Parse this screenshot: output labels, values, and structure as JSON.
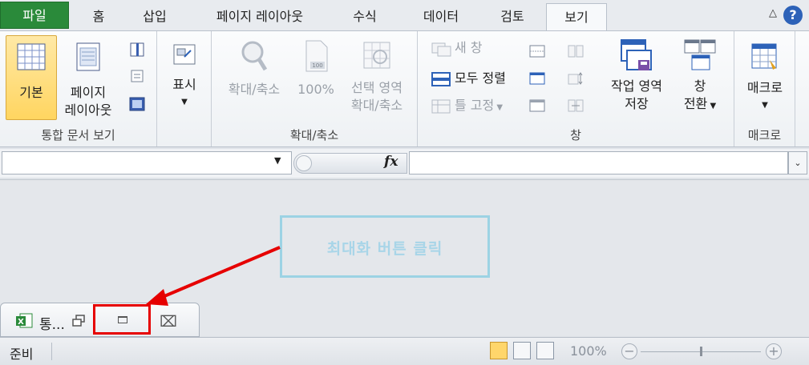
{
  "tabs": [
    {
      "label": "파일"
    },
    {
      "label": "홈"
    },
    {
      "label": "삽입"
    },
    {
      "label": "페이지 레이아웃"
    },
    {
      "label": "수식"
    },
    {
      "label": "데이터"
    },
    {
      "label": "검토"
    },
    {
      "label": "보기"
    }
  ],
  "ribbon": {
    "workbook_views": {
      "label": "통합 문서 보기",
      "normal": "기본",
      "page_layout_1": "페이지",
      "page_layout_2": "레이아웃"
    },
    "show": {
      "label": "표시"
    },
    "zoom": {
      "label": "확대/축소",
      "zoom_btn": "확대/축소",
      "hundred": "100%",
      "selection_1": "선택 영역",
      "selection_2": "확대/축소"
    },
    "window": {
      "label": "창",
      "new_window": "새 창",
      "arrange_all": "모두 정렬",
      "freeze_panes": "틀 고정",
      "save_workspace_1": "작업 영역",
      "save_workspace_2": "저장",
      "switch_1": "창",
      "switch_2": "전환"
    },
    "macros": {
      "label": "매크로",
      "btn": "매크로"
    }
  },
  "formula_bar": {
    "fx": "fx"
  },
  "annotation": {
    "callout": "최대화 버튼 클릭",
    "color": "#e60000"
  },
  "minimized_window": {
    "title": "통..."
  },
  "status": {
    "ready": "준비",
    "zoom": "100%"
  }
}
